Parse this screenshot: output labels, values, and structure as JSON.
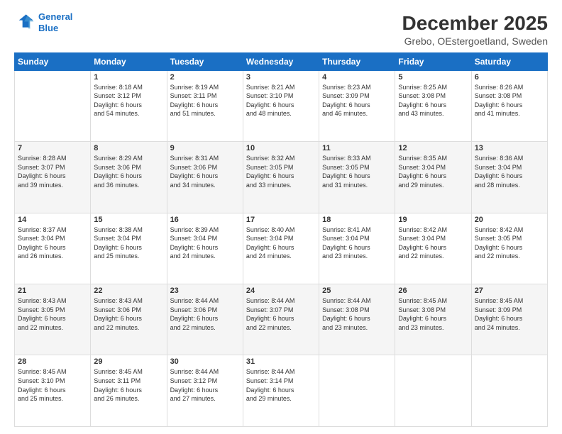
{
  "header": {
    "logo_line1": "General",
    "logo_line2": "Blue",
    "title": "December 2025",
    "subtitle": "Grebo, OEstergoetland, Sweden"
  },
  "calendar": {
    "days_of_week": [
      "Sunday",
      "Monday",
      "Tuesday",
      "Wednesday",
      "Thursday",
      "Friday",
      "Saturday"
    ],
    "weeks": [
      [
        {
          "day": "",
          "info": ""
        },
        {
          "day": "1",
          "info": "Sunrise: 8:18 AM\nSunset: 3:12 PM\nDaylight: 6 hours\nand 54 minutes."
        },
        {
          "day": "2",
          "info": "Sunrise: 8:19 AM\nSunset: 3:11 PM\nDaylight: 6 hours\nand 51 minutes."
        },
        {
          "day": "3",
          "info": "Sunrise: 8:21 AM\nSunset: 3:10 PM\nDaylight: 6 hours\nand 48 minutes."
        },
        {
          "day": "4",
          "info": "Sunrise: 8:23 AM\nSunset: 3:09 PM\nDaylight: 6 hours\nand 46 minutes."
        },
        {
          "day": "5",
          "info": "Sunrise: 8:25 AM\nSunset: 3:08 PM\nDaylight: 6 hours\nand 43 minutes."
        },
        {
          "day": "6",
          "info": "Sunrise: 8:26 AM\nSunset: 3:08 PM\nDaylight: 6 hours\nand 41 minutes."
        }
      ],
      [
        {
          "day": "7",
          "info": "Sunrise: 8:28 AM\nSunset: 3:07 PM\nDaylight: 6 hours\nand 39 minutes."
        },
        {
          "day": "8",
          "info": "Sunrise: 8:29 AM\nSunset: 3:06 PM\nDaylight: 6 hours\nand 36 minutes."
        },
        {
          "day": "9",
          "info": "Sunrise: 8:31 AM\nSunset: 3:06 PM\nDaylight: 6 hours\nand 34 minutes."
        },
        {
          "day": "10",
          "info": "Sunrise: 8:32 AM\nSunset: 3:05 PM\nDaylight: 6 hours\nand 33 minutes."
        },
        {
          "day": "11",
          "info": "Sunrise: 8:33 AM\nSunset: 3:05 PM\nDaylight: 6 hours\nand 31 minutes."
        },
        {
          "day": "12",
          "info": "Sunrise: 8:35 AM\nSunset: 3:04 PM\nDaylight: 6 hours\nand 29 minutes."
        },
        {
          "day": "13",
          "info": "Sunrise: 8:36 AM\nSunset: 3:04 PM\nDaylight: 6 hours\nand 28 minutes."
        }
      ],
      [
        {
          "day": "14",
          "info": "Sunrise: 8:37 AM\nSunset: 3:04 PM\nDaylight: 6 hours\nand 26 minutes."
        },
        {
          "day": "15",
          "info": "Sunrise: 8:38 AM\nSunset: 3:04 PM\nDaylight: 6 hours\nand 25 minutes."
        },
        {
          "day": "16",
          "info": "Sunrise: 8:39 AM\nSunset: 3:04 PM\nDaylight: 6 hours\nand 24 minutes."
        },
        {
          "day": "17",
          "info": "Sunrise: 8:40 AM\nSunset: 3:04 PM\nDaylight: 6 hours\nand 24 minutes."
        },
        {
          "day": "18",
          "info": "Sunrise: 8:41 AM\nSunset: 3:04 PM\nDaylight: 6 hours\nand 23 minutes."
        },
        {
          "day": "19",
          "info": "Sunrise: 8:42 AM\nSunset: 3:04 PM\nDaylight: 6 hours\nand 22 minutes."
        },
        {
          "day": "20",
          "info": "Sunrise: 8:42 AM\nSunset: 3:05 PM\nDaylight: 6 hours\nand 22 minutes."
        }
      ],
      [
        {
          "day": "21",
          "info": "Sunrise: 8:43 AM\nSunset: 3:05 PM\nDaylight: 6 hours\nand 22 minutes."
        },
        {
          "day": "22",
          "info": "Sunrise: 8:43 AM\nSunset: 3:06 PM\nDaylight: 6 hours\nand 22 minutes."
        },
        {
          "day": "23",
          "info": "Sunrise: 8:44 AM\nSunset: 3:06 PM\nDaylight: 6 hours\nand 22 minutes."
        },
        {
          "day": "24",
          "info": "Sunrise: 8:44 AM\nSunset: 3:07 PM\nDaylight: 6 hours\nand 22 minutes."
        },
        {
          "day": "25",
          "info": "Sunrise: 8:44 AM\nSunset: 3:08 PM\nDaylight: 6 hours\nand 23 minutes."
        },
        {
          "day": "26",
          "info": "Sunrise: 8:45 AM\nSunset: 3:08 PM\nDaylight: 6 hours\nand 23 minutes."
        },
        {
          "day": "27",
          "info": "Sunrise: 8:45 AM\nSunset: 3:09 PM\nDaylight: 6 hours\nand 24 minutes."
        }
      ],
      [
        {
          "day": "28",
          "info": "Sunrise: 8:45 AM\nSunset: 3:10 PM\nDaylight: 6 hours\nand 25 minutes."
        },
        {
          "day": "29",
          "info": "Sunrise: 8:45 AM\nSunset: 3:11 PM\nDaylight: 6 hours\nand 26 minutes."
        },
        {
          "day": "30",
          "info": "Sunrise: 8:44 AM\nSunset: 3:12 PM\nDaylight: 6 hours\nand 27 minutes."
        },
        {
          "day": "31",
          "info": "Sunrise: 8:44 AM\nSunset: 3:14 PM\nDaylight: 6 hours\nand 29 minutes."
        },
        {
          "day": "",
          "info": ""
        },
        {
          "day": "",
          "info": ""
        },
        {
          "day": "",
          "info": ""
        }
      ]
    ]
  }
}
